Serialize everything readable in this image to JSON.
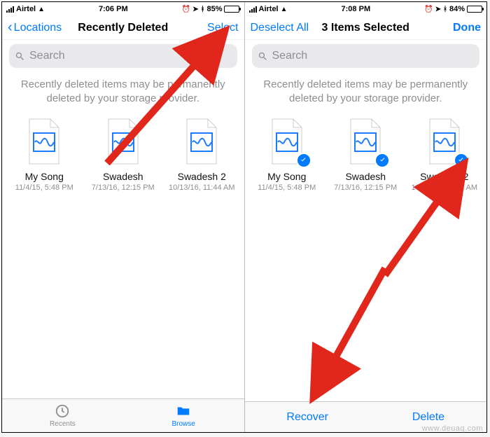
{
  "status": {
    "carrier": "Airtel",
    "time_left": "7:06 PM",
    "time_right": "7:08 PM",
    "battery_left_pct": 85,
    "battery_right_pct": 84,
    "battery_left_label": "85%",
    "battery_right_label": "84%"
  },
  "left": {
    "nav_back": "Locations",
    "nav_title": "Recently Deleted",
    "nav_action": "Select",
    "search_placeholder": "Search",
    "notice": "Recently deleted items may be permanently deleted by your storage provider.",
    "items": [
      {
        "name": "My Song",
        "date": "11/4/15, 5:48 PM"
      },
      {
        "name": "Swadesh",
        "date": "7/13/16, 12:15 PM"
      },
      {
        "name": "Swadesh 2",
        "date": "10/13/16, 11:44 AM"
      }
    ],
    "tabs": {
      "recents": "Recents",
      "browse": "Browse"
    }
  },
  "right": {
    "nav_back": "Deselect All",
    "nav_title": "3 Items Selected",
    "nav_action": "Done",
    "search_placeholder": "Search",
    "notice": "Recently deleted items may be permanently deleted by your storage provider.",
    "items": [
      {
        "name": "My Song",
        "date": "11/4/15, 5:48 PM"
      },
      {
        "name": "Swadesh",
        "date": "7/13/16, 12:15 PM"
      },
      {
        "name": "Swadesh 2",
        "date": "10/13/16, 11:44 AM"
      }
    ],
    "toolbar": {
      "recover": "Recover",
      "delete": "Delete"
    }
  },
  "watermark": "www.deuaq.com"
}
